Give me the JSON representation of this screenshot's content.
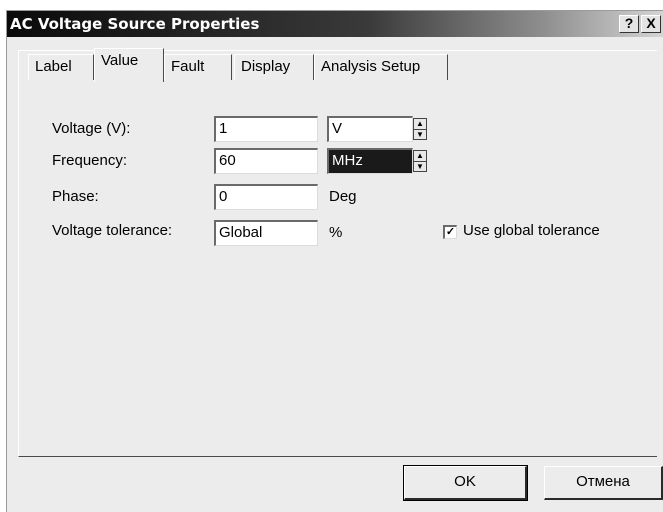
{
  "window": {
    "title": "AC Voltage Source Properties",
    "help_label": "?",
    "close_label": "X"
  },
  "tabs": [
    {
      "label": "Label",
      "active": false
    },
    {
      "label": "Value",
      "active": true
    },
    {
      "label": "Fault",
      "active": false
    },
    {
      "label": "Display",
      "active": false
    },
    {
      "label": "Analysis Setup",
      "active": false
    }
  ],
  "form": {
    "voltage": {
      "label": "Voltage (V):",
      "value": "1",
      "unit": "V"
    },
    "frequency": {
      "label": "Frequency:",
      "value": "60",
      "unit": "MHz"
    },
    "phase": {
      "label": "Phase:",
      "value": "0",
      "unit": "Deg"
    },
    "tolerance": {
      "label": "Voltage tolerance:",
      "value": "Global",
      "unit": "%"
    },
    "use_global_tolerance": {
      "label": "Use global tolerance",
      "checked": true,
      "mark": "✓"
    }
  },
  "buttons": {
    "ok": "OK",
    "cancel": "Отмена"
  }
}
